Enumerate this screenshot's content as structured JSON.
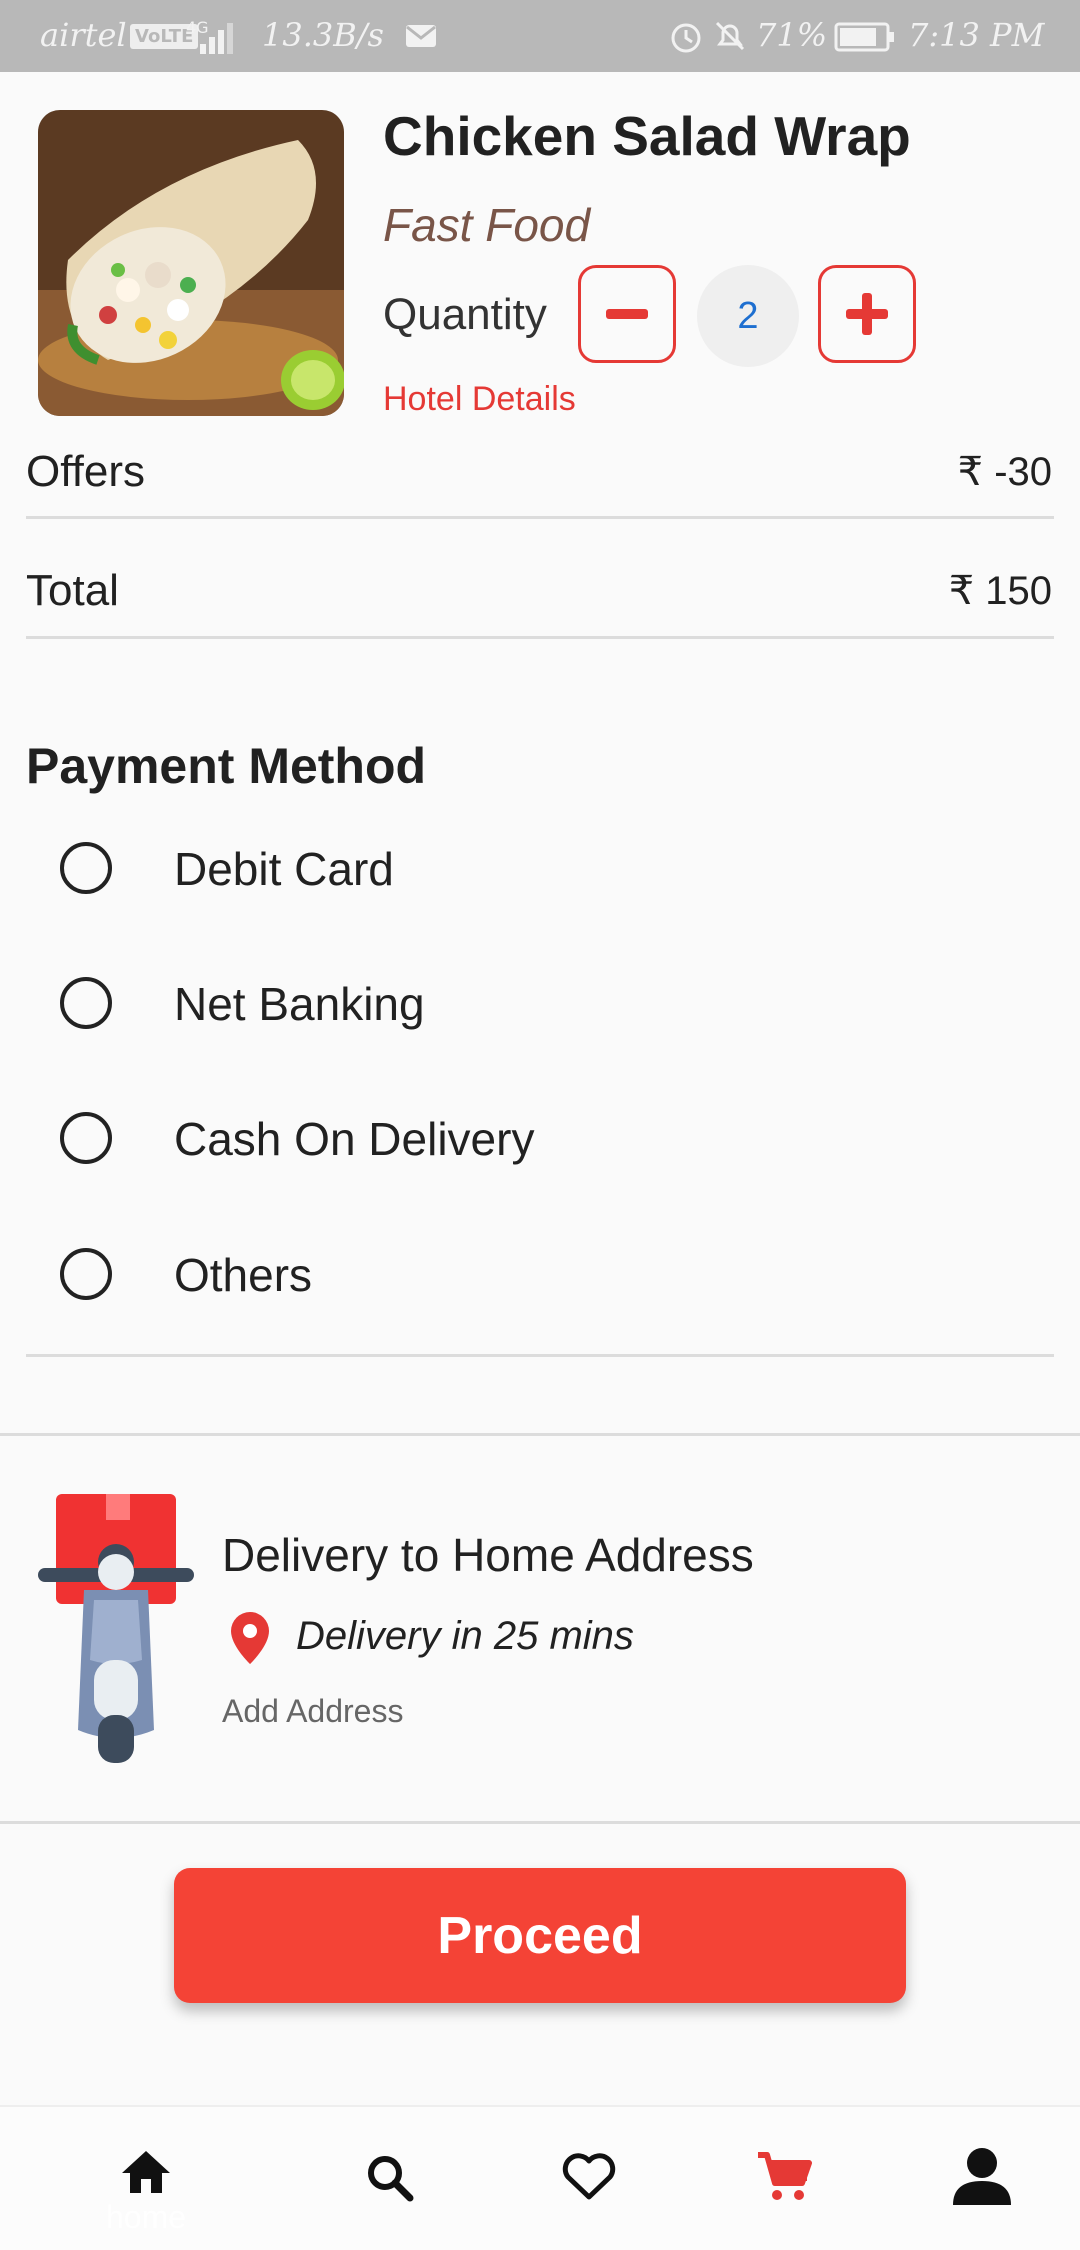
{
  "status_bar": {
    "carrier": "airtel",
    "volte": "VoLTE",
    "network": "4G",
    "speed": "13.3B/s",
    "battery": "71%",
    "time": "7:13 PM"
  },
  "product": {
    "title": "Chicken Salad Wrap",
    "category": "Fast Food",
    "quantity_label": "Quantity",
    "quantity": "2",
    "hotel_link": "Hotel Details"
  },
  "summary": {
    "offers_label": "Offers",
    "offers_value": "₹ -30",
    "total_label": "Total",
    "total_value": "₹ 150"
  },
  "payment": {
    "title": "Payment Method",
    "options": [
      "Debit Card",
      "Net Banking",
      "Cash On Delivery",
      "Others"
    ]
  },
  "delivery": {
    "title": "Delivery to Home Address",
    "time": "Delivery in 25 mins",
    "add_address": "Add Address"
  },
  "actions": {
    "proceed": "Proceed"
  },
  "bottom_nav": {
    "items": [
      {
        "icon": "home-icon",
        "label": "home"
      },
      {
        "icon": "search-icon"
      },
      {
        "icon": "heart-icon"
      },
      {
        "icon": "cart-icon"
      },
      {
        "icon": "profile-icon"
      }
    ],
    "active_color": "#e53935"
  },
  "colors": {
    "accent": "#f44336",
    "link": "#e53935",
    "category": "#795548",
    "quantity": "#1e6fd0"
  }
}
